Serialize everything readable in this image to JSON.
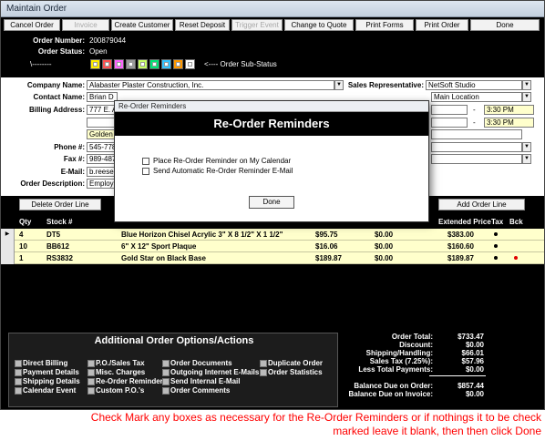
{
  "window": {
    "title": "Maintain  Order"
  },
  "toolbar": {
    "buttons": [
      "Cancel Order",
      "Invoice",
      "Create Customer",
      "Reset Deposit",
      "Trigger Event",
      "Change to Quote",
      "Print Forms",
      "Print Order",
      "Done"
    ]
  },
  "header": {
    "order_number_label": "Order Number:",
    "order_number": "200879044",
    "order_status_label": "Order Status:",
    "order_status": "Open",
    "sub_status_lead": "\\--------",
    "sub_status_label": "<---- Order Sub-Status"
  },
  "form": {
    "company_label": "Company Name:",
    "company_value": "Alabaster Plaster Construction, Inc.",
    "contact_label": "Contact Name:",
    "contact_value": "Brian D",
    "billing_label": "Billing Address:",
    "billing_line1": "777 E. A",
    "billing_line3": "Golden",
    "phone_label": "Phone #:",
    "phone_value": "545-778",
    "fax_label": "Fax #:",
    "fax_value": "989-487",
    "email_label": "E-Mail:",
    "email_value": "b.reese",
    "desc_label": "Order Description:",
    "desc_value": "Employ",
    "sales_rep_label": "Sales Representative:",
    "sales_rep_value": "NetSoft Studio",
    "location_value": "Main Location",
    "time1": "3:30 PM",
    "time2": "3:30 PM",
    "dash1": "-",
    "dash2": "-"
  },
  "lines_bar": {
    "delete_label": "Delete Order Line",
    "add_label": "Add Order Line",
    "cols": [
      "Qty",
      "Stock #",
      "Extended Price",
      "Tax",
      "Bck"
    ]
  },
  "lines": [
    {
      "qty": "4",
      "stock": "DT5",
      "desc": "Blue Horizon Chisel Acrylic 3\" X 8 1/2\" X 1 1/2\"",
      "price": "$95.75",
      "disc": "$0.00",
      "ext": "$383.00",
      "tax": true,
      "bck": false
    },
    {
      "qty": "10",
      "stock": "BB612",
      "desc": "6\" X 12\" Sport Plaque",
      "price": "$16.06",
      "disc": "$0.00",
      "ext": "$160.60",
      "tax": true,
      "bck": false
    },
    {
      "qty": "1",
      "stock": "RS3832",
      "desc": "Gold Star on Black Base",
      "price": "$189.87",
      "disc": "$0.00",
      "ext": "$189.87",
      "tax": true,
      "bck": true
    }
  ],
  "options": {
    "title": "Additional Order Options/Actions",
    "items": [
      [
        "Direct Billing",
        "Payment Details",
        "Shipping Details",
        "Calendar Event"
      ],
      [
        "P.O./Sales Tax",
        "Misc. Charges",
        "Re-Order Reminders",
        "Custom P.O.'s"
      ],
      [
        "Order Documents",
        "Outgoing Internet E-Mails",
        "Send Internal E-Mail",
        "Order Comments"
      ],
      [
        "Duplicate Order",
        "Order Statistics"
      ]
    ]
  },
  "totals": [
    {
      "label": "Order Total:",
      "value": "$733.47"
    },
    {
      "label": "Discount:",
      "value": "$0.00"
    },
    {
      "label": "Shipping/Handling:",
      "value": "$66.01"
    },
    {
      "label": "Sales Tax (7.25%):",
      "value": "$57.96"
    },
    {
      "label": "Less Total Payments:",
      "value": "$0.00"
    },
    {
      "label": "Balance Due on Order:",
      "value": "$857.44"
    },
    {
      "label": "Balance Due on Invoice:",
      "value": "$0.00"
    }
  ],
  "dialog": {
    "titlebar": "Re-Order Reminders",
    "heading": "Re-Order Reminders",
    "option1": "Place Re-Order Reminder on My Calendar",
    "option2": "Send Automatic Re-Order Reminder E-Mail",
    "option1_checked": false,
    "option2_checked": false,
    "done_label": "Done"
  },
  "instruction": "Check Mark any boxes as necessary for the Re-Order Reminders or if nothings it to be check marked leave it blank, then then click Done",
  "colors": {
    "instruction": "#ff0000",
    "row_bg": "#ffffcc",
    "panel_bg": "#000000",
    "swatches": [
      "#ffee00",
      "#ff5050",
      "#ff66ff",
      "#9a9a9a",
      "#c8ff66",
      "#00e676",
      "#33c4ff",
      "#ff9900",
      "#ffffff"
    ]
  }
}
